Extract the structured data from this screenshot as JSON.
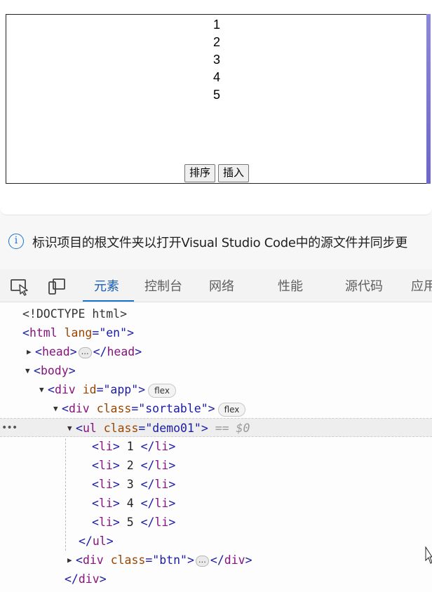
{
  "preview": {
    "list_items": [
      "1",
      "2",
      "3",
      "4",
      "5"
    ],
    "buttons": {
      "sort": "排序",
      "insert": "插入"
    }
  },
  "infobar": {
    "icon": "info-icon",
    "text": "标识项目的根文件夹以打开Visual Studio Code中的源文件并同步更"
  },
  "devtools": {
    "tabs": [
      "元素",
      "控制台",
      "网络",
      "性能",
      "源代码",
      "应用"
    ],
    "active_tab": "元素",
    "toolbar_icons": [
      "inspect-element-icon",
      "device-emulation-icon"
    ],
    "accent_color": "#1a73c8"
  },
  "dom_tree": {
    "doctype": "<!DOCTYPE html>",
    "html": {
      "tag": "html",
      "attr": "lang",
      "value": "\"en\""
    },
    "head": {
      "tag": "head",
      "ellipsis": "…"
    },
    "body": {
      "tag": "body"
    },
    "app_div": {
      "tag": "div",
      "attr": "id",
      "value": "\"app\"",
      "badge": "flex"
    },
    "sortable_div": {
      "tag": "div",
      "attr": "class",
      "value": "\"sortable\"",
      "badge": "flex"
    },
    "ul": {
      "tag": "ul",
      "attr": "class",
      "value": "\"demo01\"",
      "selected_ref": "== $0",
      "row_menu": "•••"
    },
    "li_texts": [
      "1",
      "2",
      "3",
      "4",
      "5"
    ],
    "li_tag": "li",
    "btn_div": {
      "tag": "div",
      "attr": "class",
      "value": "\"btn\"",
      "ellipsis": "…"
    },
    "close_ul": "ul",
    "close_div": "div"
  }
}
